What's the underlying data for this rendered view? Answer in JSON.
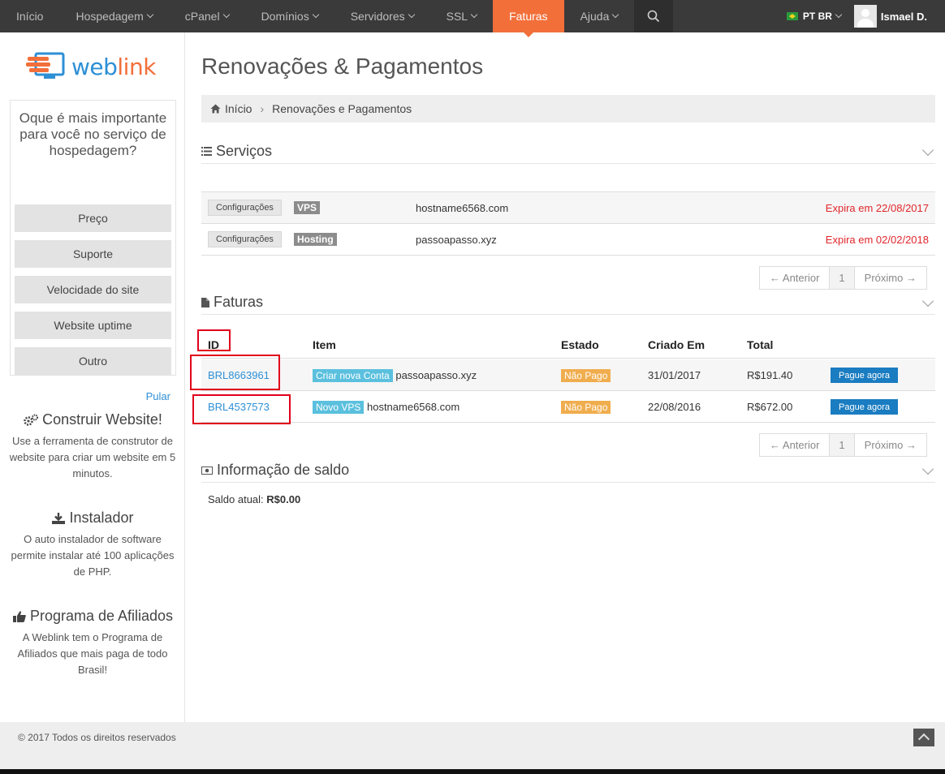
{
  "nav": {
    "items": [
      {
        "label": "Início",
        "caret": false
      },
      {
        "label": "Hospedagem",
        "caret": true
      },
      {
        "label": "cPanel",
        "caret": true
      },
      {
        "label": "Domínios",
        "caret": true
      },
      {
        "label": "Servidores",
        "caret": true
      },
      {
        "label": "SSL",
        "caret": true
      },
      {
        "label": "Faturas",
        "caret": false,
        "active": true
      },
      {
        "label": "Ajuda",
        "caret": true
      }
    ],
    "language": "PT BR",
    "user": "Ismael D.",
    "active_color": "#f26f3a"
  },
  "sidebar": {
    "logo": {
      "prefix": "web",
      "suffix": "link"
    },
    "poll": {
      "question": "Oque é mais importante para você no serviço de hospedagem?",
      "options": [
        "Preço",
        "Suporte",
        "Velocidade do site",
        "Website uptime",
        "Outro"
      ],
      "skip": "Pular"
    },
    "builder": {
      "title": "Construir Website!",
      "text": "Use a ferramenta de construtor de website para criar um website em 5 minutos.",
      "icon": "gears-icon"
    },
    "installer": {
      "title": "Instalador",
      "text": "O auto instalador de software permite instalar até 100 aplicações de PHP.",
      "icon": "download-icon"
    },
    "affiliates": {
      "title": "Programa de Afiliados",
      "text": "A Weblink tem o Programa de Afiliados que mais paga de todo Brasil!",
      "icon": "thumbs-up-icon"
    }
  },
  "main": {
    "title": "Renovações & Pagamentos",
    "breadcrumb": {
      "home": "Início",
      "current": "Renovações e Pagamentos"
    },
    "services": {
      "heading": "Serviços",
      "rows": [
        {
          "config": "Configurações",
          "type": "VPS",
          "domain": "hostname6568.com",
          "expires": "Expira em 22/08/2017"
        },
        {
          "config": "Configurações",
          "type": "Hosting",
          "domain": "passoapasso.xyz",
          "expires": "Expira em 02/02/2018"
        }
      ]
    },
    "pager": {
      "prev": "← Anterior",
      "page": "1",
      "next": "Próximo →"
    },
    "invoices": {
      "heading": "Faturas",
      "columns": {
        "id": "ID",
        "item": "Item",
        "status": "Estado",
        "created": "Criado Em",
        "total": "Total"
      },
      "rows": [
        {
          "id": "BRL8663961",
          "tag": "Criar nova Conta",
          "item": "passoapasso.xyz",
          "status": "Não Pago",
          "created": "31/01/2017",
          "total": "R$191.40",
          "action": "Pague agora"
        },
        {
          "id": "BRL4537573",
          "tag": "Novo VPS",
          "item": "hostname6568.com",
          "status": "Não Pago",
          "created": "22/08/2016",
          "total": "R$672.00",
          "action": "Pague agora"
        }
      ]
    },
    "balance": {
      "heading": "Informação de saldo",
      "label": "Saldo atual:",
      "value": "R$0.00"
    }
  },
  "footer": {
    "copyright": "© 2017 Todos os direitos reservados"
  }
}
